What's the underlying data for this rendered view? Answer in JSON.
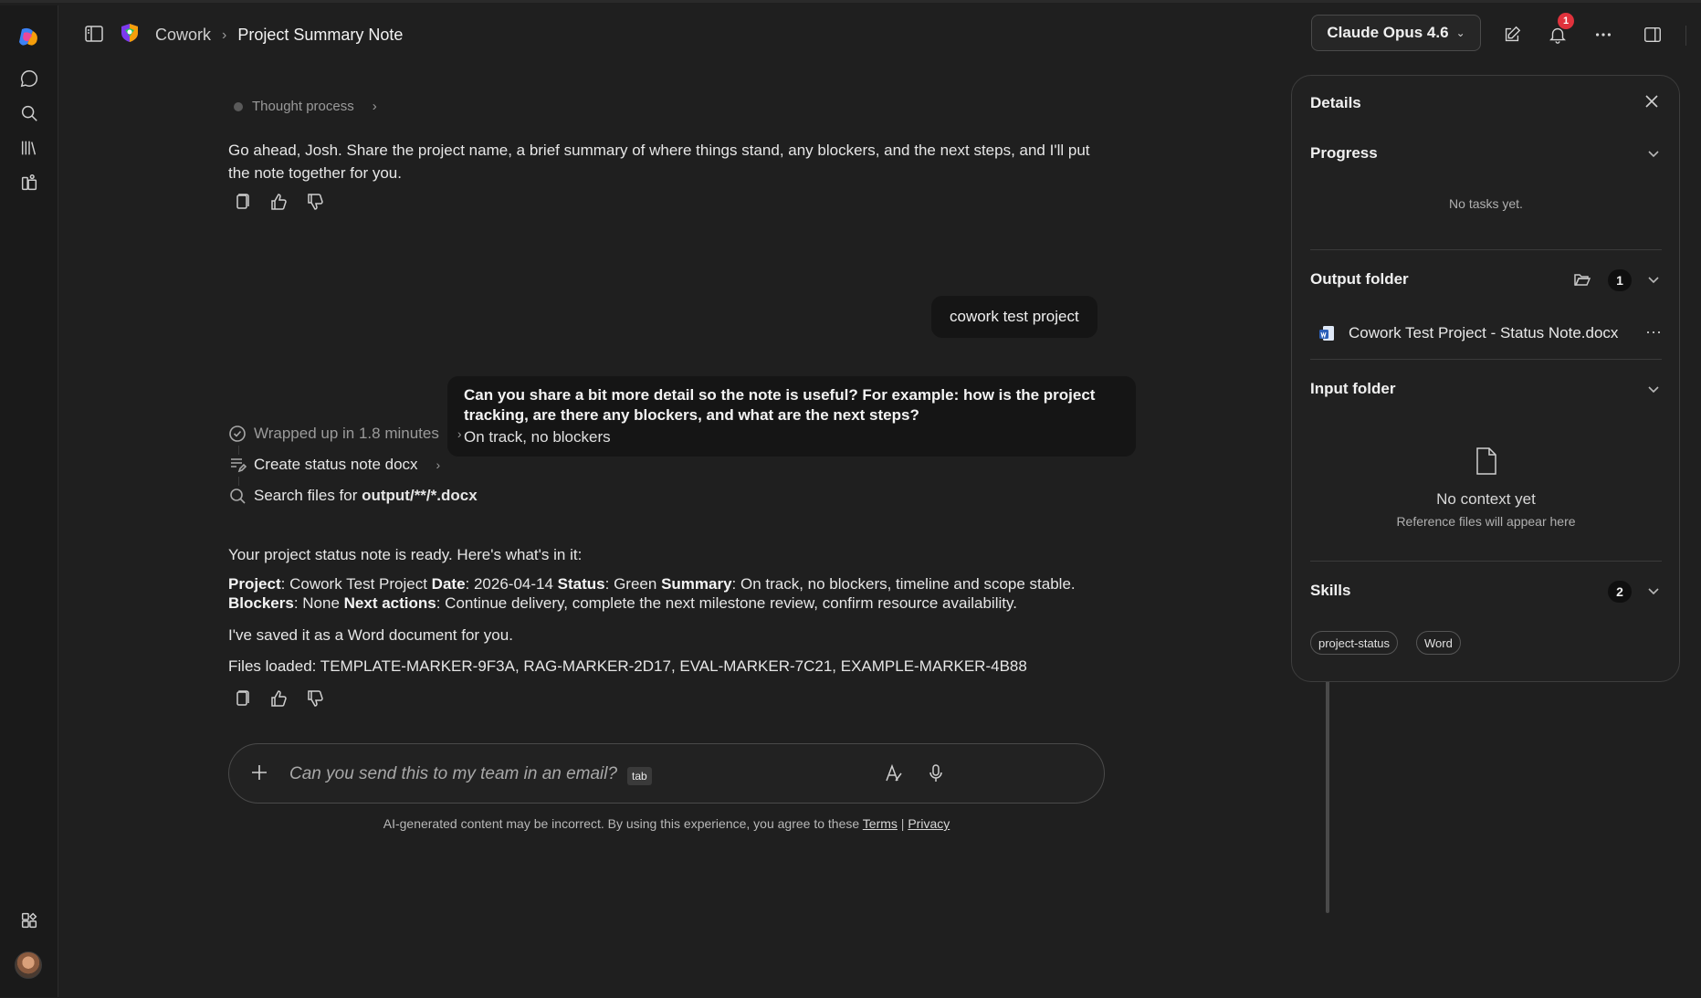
{
  "breadcrumb": {
    "root": "Cowork",
    "current": "Project Summary Note"
  },
  "header": {
    "model_label": "Claude Opus 4.6",
    "notification_count": "1"
  },
  "chat": {
    "thought_label": "Thought process",
    "intro": "Go ahead, Josh. Share the project name, a brief summary of where things stand, any blockers, and the next steps, and I'll put the note together for you.",
    "user_message": "cowork test project",
    "question": "Can you share a bit more detail so the note is useful? For example: how is the project tracking, are there any blockers, and what are the next steps?",
    "answer": "On track, no blockers",
    "steps": {
      "wrapped": "Wrapped up in 1.8 minutes",
      "create": "Create status note docx",
      "search_prefix": "Search files for ",
      "search_pattern": "output/**/*.docx"
    },
    "ready": "Your project status note is ready. Here's what's in it:",
    "status": {
      "project_label": "Project",
      "project_value": ": Cowork Test Project ",
      "date_label": "Date",
      "date_value": ": 2026-04-14 ",
      "status_label": "Status",
      "status_value": ": Green ",
      "summary_label": "Summary",
      "summary_value": ": On track, no blockers, timeline and scope stable.",
      "blockers_label": "Blockers",
      "blockers_value": ": None ",
      "next_label": "Next actions",
      "next_value": ": Continue delivery, complete the next milestone review, confirm resource availability."
    },
    "saved": "I've saved it as a Word document for you.",
    "files_loaded": "Files loaded: TEMPLATE-MARKER-9F3A, RAG-MARKER-2D17, EVAL-MARKER-7C21, EXAMPLE-MARKER-4B88"
  },
  "composer": {
    "placeholder": "Can you send this to my team in an email?",
    "tab_hint": "tab"
  },
  "footer": {
    "disclaimer": "AI-generated content may be incorrect. By using this experience, you agree to these ",
    "terms": "Terms",
    "sep": " | ",
    "privacy": "Privacy"
  },
  "details": {
    "title": "Details",
    "progress": {
      "heading": "Progress",
      "empty": "No tasks yet."
    },
    "output": {
      "heading": "Output folder",
      "count": "1",
      "file": "Cowork Test Project - Status Note.docx"
    },
    "input": {
      "heading": "Input folder",
      "empty_title": "No context yet",
      "empty_sub": "Reference files will appear here"
    },
    "skills": {
      "heading": "Skills",
      "count": "2",
      "items": [
        "project-status",
        "Word"
      ]
    }
  },
  "colors": {
    "background": "#1f1f1f",
    "badge": "#e0323c",
    "word_blue": "#2b5fb8"
  }
}
